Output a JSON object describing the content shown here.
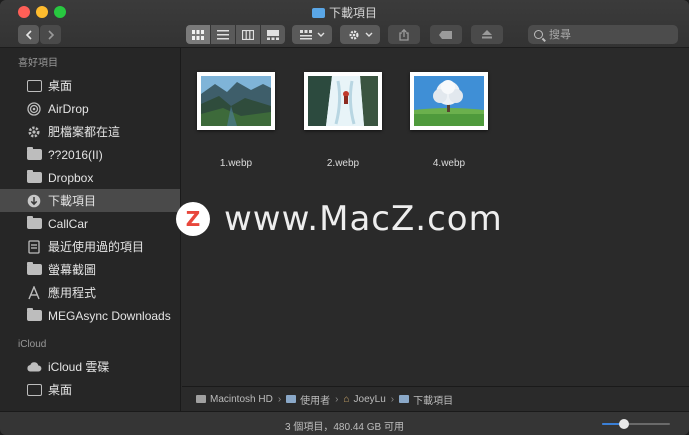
{
  "window": {
    "title": "下載項目"
  },
  "toolbar": {
    "view_modes": [
      "icon-view",
      "list-view",
      "column-view",
      "gallery-view"
    ],
    "group_button": "group-icon",
    "action_button": "gear-icon",
    "share_button": "share-icon",
    "tag_button": "tag-icon",
    "eject_button": "eject-icon",
    "search_placeholder": "搜尋"
  },
  "sidebar": {
    "favorites_header": "喜好項目",
    "favorites": [
      {
        "label": "桌面",
        "icon": "desktop-icon"
      },
      {
        "label": "AirDrop",
        "icon": "airdrop-icon"
      },
      {
        "label": "肥檔案都在這",
        "icon": "gear-icon"
      },
      {
        "label": "??2016(II)",
        "icon": "folder-icon"
      },
      {
        "label": "Dropbox",
        "icon": "folder-icon"
      },
      {
        "label": "下載項目",
        "icon": "download-icon",
        "selected": true
      },
      {
        "label": "CallCar",
        "icon": "folder-icon"
      },
      {
        "label": "最近使用過的項目",
        "icon": "recent-icon"
      },
      {
        "label": "螢幕截圖",
        "icon": "folder-icon"
      },
      {
        "label": "應用程式",
        "icon": "applications-icon"
      },
      {
        "label": "MEGAsync Downloads",
        "icon": "folder-icon"
      }
    ],
    "icloud_header": "iCloud",
    "icloud": [
      {
        "label": "iCloud 雲碟",
        "icon": "cloud-icon"
      },
      {
        "label": "桌面",
        "icon": "desktop-icon"
      }
    ]
  },
  "files": [
    {
      "name": "1.webp",
      "subject": "mountain-valley"
    },
    {
      "name": "2.webp",
      "subject": "waterfall-climber"
    },
    {
      "name": "4.webp",
      "subject": "blossom-tree"
    }
  ],
  "watermark": {
    "logo_letter": "Z",
    "text": "www.MacZ.com"
  },
  "pathbar": {
    "segments": [
      "Macintosh HD",
      "使用者",
      "JoeyLu",
      "下載項目"
    ]
  },
  "statusbar": {
    "text": "3 個項目，480.44 GB 可用",
    "zoom_level": 0.3
  },
  "colors": {
    "selection": "#4a4a4a",
    "accent": "#3a7fd6",
    "folder_blue": "#5aa6e6"
  }
}
